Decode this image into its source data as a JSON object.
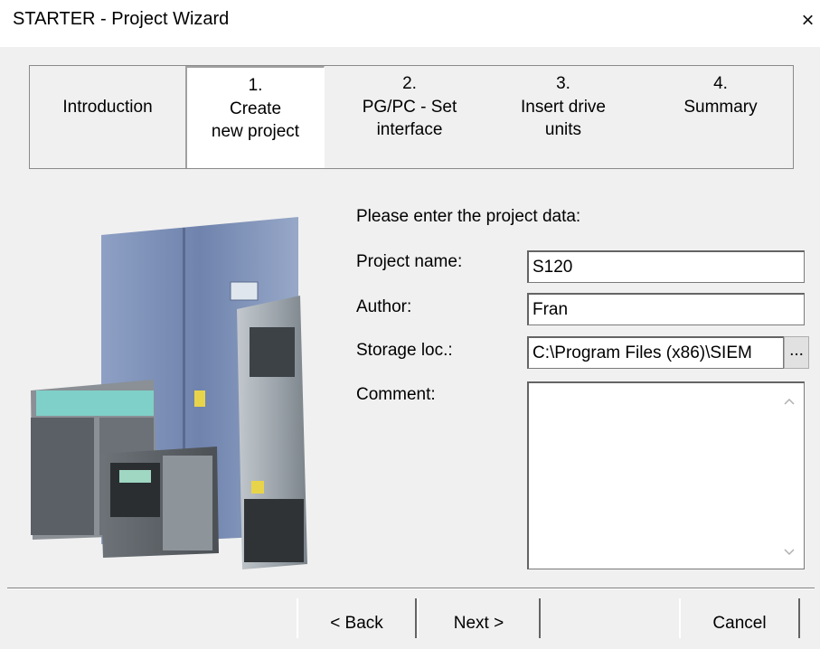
{
  "window": {
    "title": "STARTER - Project Wizard",
    "close_glyph": "×"
  },
  "steps": [
    {
      "line1": "Introduction",
      "line2": "",
      "line3": ""
    },
    {
      "line1": "1.",
      "line2": "Create",
      "line3": "new project"
    },
    {
      "line1": "2.",
      "line2": "PG/PC - Set",
      "line3": "interface"
    },
    {
      "line1": "3.",
      "line2": "Insert drive",
      "line3": "units"
    },
    {
      "line1": "4.",
      "line2": "Summary",
      "line3": ""
    }
  ],
  "form": {
    "prompt": "Please enter the project data:",
    "project_name_label": "Project name:",
    "project_name_value": "S120",
    "author_label": "Author:",
    "author_value": "Fran",
    "storage_label": "Storage loc.:",
    "storage_value": "C:\\Program Files (x86)\\SIEM",
    "browse_label": "...",
    "comment_label": "Comment:",
    "comment_value": ""
  },
  "buttons": {
    "back": "< Back",
    "next": "Next >",
    "cancel": "Cancel"
  },
  "colors": {
    "drive_gray": "#a9b0b6",
    "cabinet_blue": "#7d8fb0",
    "accent_teal": "#7fd0c8",
    "warning_yellow": "#e8d44a"
  }
}
